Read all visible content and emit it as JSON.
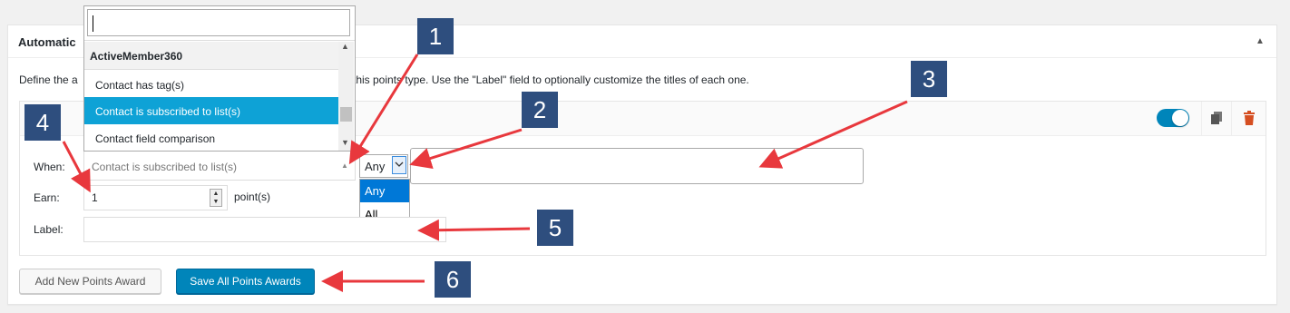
{
  "panel": {
    "title": "Automatic",
    "description_prefix": "Define the a",
    "description_suffix": "this points type. Use the \"Label\" field to optionally customize the titles of each one.",
    "collapse_icon": "triangle-up-icon"
  },
  "award": {
    "enabled": true,
    "when_label": "When:",
    "when_value": "Contact is subscribed to list(s)",
    "match_value": "Any",
    "match_options": [
      "Any",
      "All"
    ],
    "earn_label": "Earn:",
    "earn_value": "1",
    "points_text": "point(s)",
    "label_label": "Label:",
    "label_value": ""
  },
  "dropdown": {
    "search_value": "",
    "group": "ActiveMember360",
    "options": [
      "Contact has tag(s)",
      "Contact is subscribed to list(s)",
      "Contact field comparison"
    ],
    "selected": "Contact is subscribed to list(s)"
  },
  "buttons": {
    "add": "Add New Points Award",
    "save": "Save All Points Awards"
  },
  "callouts": [
    "1",
    "2",
    "3",
    "4",
    "5",
    "6"
  ],
  "colors": {
    "primary": "#0085ba",
    "callout": "#2e4e7e",
    "arrow": "#e8383d",
    "highlight": "#0ea2d6",
    "trash": "#d54e21"
  }
}
